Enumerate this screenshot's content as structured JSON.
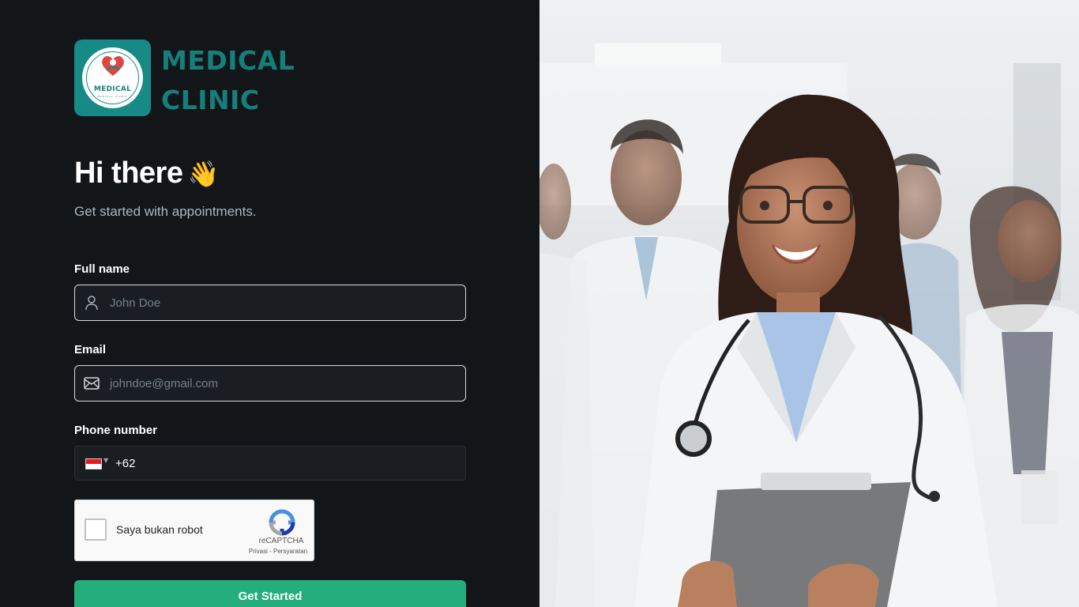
{
  "brand": {
    "line1": "MEDICAL",
    "line2": "CLINIC",
    "logo_text": "MEDICAL",
    "logo_subtext": "MEDICAL CLINIC"
  },
  "greeting": {
    "title": "Hi there",
    "emoji": "👋",
    "subtitle": "Get started with appointments."
  },
  "form": {
    "full_name": {
      "label": "Full name",
      "placeholder": "John Doe"
    },
    "email": {
      "label": "Email",
      "placeholder": "johndoe@gmail.com"
    },
    "phone": {
      "label": "Phone number",
      "dial_code": "+62",
      "country": "ID"
    }
  },
  "captcha": {
    "label": "Saya bukan robot",
    "brand": "reCAPTCHA",
    "links": "Privasi - Persyaratan"
  },
  "submit": {
    "label": "Get Started"
  },
  "colors": {
    "accent": "#24ae7c",
    "brand_teal": "#157f7b",
    "background": "#131619",
    "input_bg": "#1a1d21"
  }
}
